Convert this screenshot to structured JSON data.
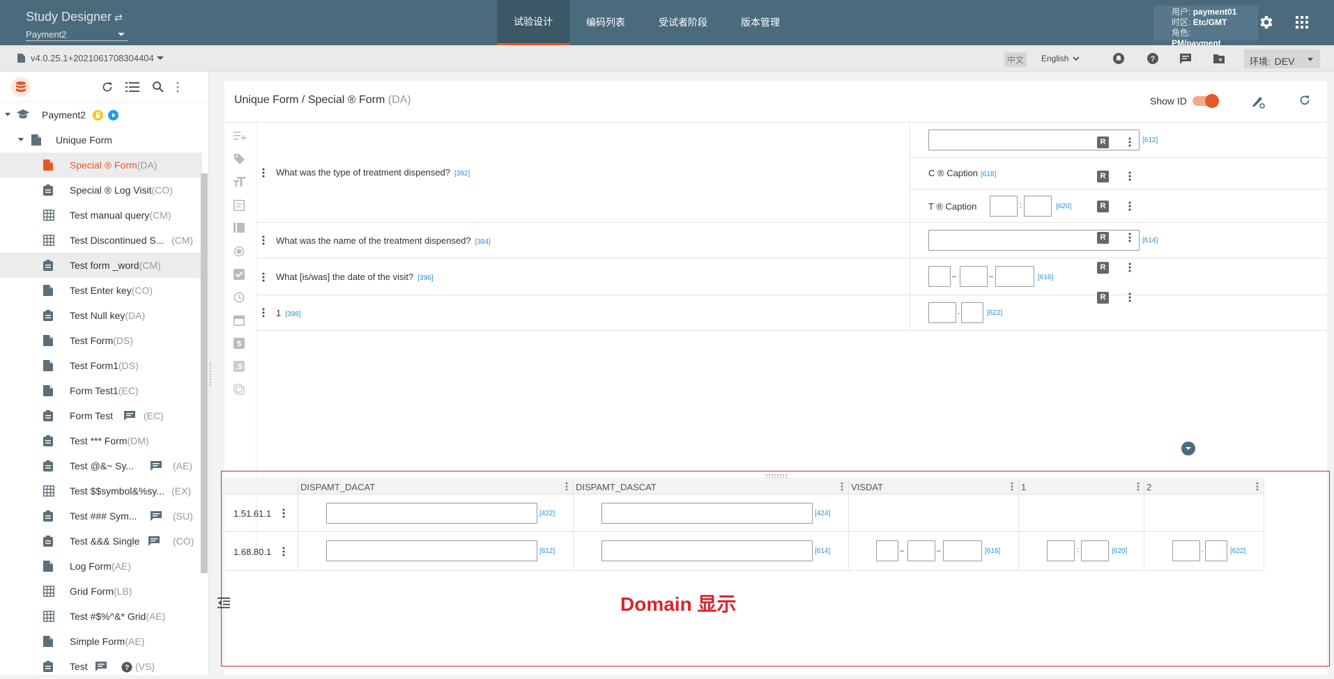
{
  "app": {
    "title": "Study Designer",
    "switch_glyph": "⇄",
    "study_name": "Payment2"
  },
  "main_tabs": [
    {
      "label": "试验设计"
    },
    {
      "label": "编码列表"
    },
    {
      "label": "受试者阶段"
    },
    {
      "label": "版本管理"
    }
  ],
  "user": {
    "user_key": "用户:",
    "user_val": "payment01",
    "tz_key": "时区:",
    "tz_val": "Etc/GMT",
    "role_key": "角色:",
    "role_val": "PM/payment"
  },
  "subbar": {
    "version": "v4.0.25.1+2021061708304404",
    "lang_cn": "中文",
    "lang_en": "English",
    "env_label": "环境:",
    "env_value": "DEV"
  },
  "tree": {
    "study": "Payment2",
    "folder": "Unique Form",
    "items": [
      {
        "label": "Special ® Form",
        "type": "(DA)",
        "icon": "form-icon-orange"
      },
      {
        "label": "Special ® Log Visit",
        "type": "(CO)",
        "icon": "clipboard-icon"
      },
      {
        "label": "Test manual query",
        "type": "(CM)",
        "icon": "grid-icon"
      },
      {
        "label": "Test Discontinued S...",
        "type": "(CM)",
        "icon": "grid-icon",
        "type_right": true
      },
      {
        "label": "Test form _word",
        "type": "(CM)",
        "icon": "clipboard-icon"
      },
      {
        "label": "Test Enter key",
        "type": "(CO)",
        "icon": "form-icon"
      },
      {
        "label": "Test Null key",
        "type": "(DA)",
        "icon": "clipboard-icon"
      },
      {
        "label": "Test Form",
        "type": "(DS)",
        "icon": "form-icon"
      },
      {
        "label": "Test Form1",
        "type": "(DS)",
        "icon": "form-icon"
      },
      {
        "label": "Form Test1",
        "type": "(EC)",
        "icon": "form-icon"
      },
      {
        "label": "Form Test",
        "type": "(EC)",
        "icon": "clipboard-icon",
        "comment": true
      },
      {
        "label": "Test *** Form",
        "type": "(DM)",
        "icon": "clipboard-icon"
      },
      {
        "label": "Test @&~ Sy...",
        "type": "(AE)",
        "icon": "clipboard-icon",
        "comment": true,
        "type_right": true
      },
      {
        "label": "Test $$symbol&%sy...",
        "type": "(EX)",
        "icon": "grid-icon",
        "type_right": true
      },
      {
        "label": "Test ### Sym...",
        "type": "(SU)",
        "icon": "clipboard-icon",
        "comment": true,
        "type_right": true
      },
      {
        "label": "Test &&& Single",
        "type": "(CO)",
        "icon": "clipboard-icon",
        "comment": true,
        "type_right": true
      },
      {
        "label": "Log Form",
        "type": "(AE)",
        "icon": "form-icon"
      },
      {
        "label": "Grid Form",
        "type": "(LB)",
        "icon": "grid-icon"
      },
      {
        "label": "Test #$%^&* Grid",
        "type": "(AE)",
        "icon": "grid-icon"
      },
      {
        "label": "Simple Form",
        "type": "(AE)",
        "icon": "form-icon"
      },
      {
        "label": "Test",
        "type": "(VS)",
        "icon": "clipboard-icon",
        "comment": true,
        "help": true
      }
    ]
  },
  "content": {
    "crumb": "Unique Form / Special ® Form",
    "crumb_type": "(DA)",
    "show_id": "Show ID",
    "questions": [
      {
        "text": "What was the type of treatment dispensed?",
        "id": "[392]"
      },
      {
        "text": "What was the name of the treatment dispensed?",
        "id": "[394]"
      },
      {
        "text": "What [is/was] the date of the visit?",
        "id": "[396]"
      },
      {
        "text": "1",
        "id": "[398]"
      }
    ],
    "items": {
      "i612": "[612]",
      "c_caption": "C ® Caption",
      "i618": "[618]",
      "t_caption": "T ® Caption",
      "colon": ":",
      "i620": "[620]",
      "i614": "[614]",
      "dash": "–",
      "i616": "[616]",
      "dot": ".",
      "i622": "[622]"
    },
    "r_badge": "R"
  },
  "domain": {
    "columns": [
      "DISPAMT_DACAT",
      "DISPAMT_DASCAT",
      "VISDAT",
      "1",
      "2"
    ],
    "rows": [
      {
        "label": "1.51.61.1",
        "ids": [
          "[422]",
          "[424]"
        ]
      },
      {
        "label": "1.68.80.1",
        "ids": [
          "[612]",
          "[614]",
          "[616]",
          "[620]",
          "[622]"
        ]
      }
    ],
    "annotation": "Domain 显示"
  },
  "colors": {
    "accent": "#e8572a",
    "topbar": "#4a6b7c",
    "id_blue": "#2a8fd6",
    "domain_red": "#d9242a"
  }
}
